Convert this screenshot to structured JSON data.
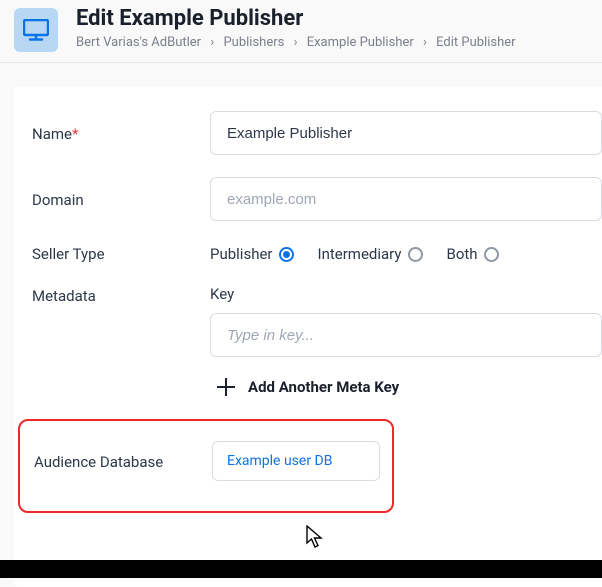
{
  "header": {
    "title": "Edit Example Publisher",
    "breadcrumb": [
      "Bert Varias's AdButler",
      "Publishers",
      "Example Publisher",
      "Edit Publisher"
    ]
  },
  "form": {
    "name": {
      "label": "Name",
      "required": "*",
      "value": "Example Publisher"
    },
    "domain": {
      "label": "Domain",
      "placeholder": "example.com"
    },
    "seller_type": {
      "label": "Seller Type",
      "options": [
        {
          "label": "Publisher",
          "selected": true
        },
        {
          "label": "Intermediary",
          "selected": false
        },
        {
          "label": "Both",
          "selected": false
        }
      ]
    },
    "metadata": {
      "label": "Metadata",
      "key_label": "Key",
      "key_placeholder": "Type in key...",
      "add_label": "Add Another Meta Key"
    },
    "audience_db": {
      "label": "Audience Database",
      "value": "Example user DB"
    }
  }
}
